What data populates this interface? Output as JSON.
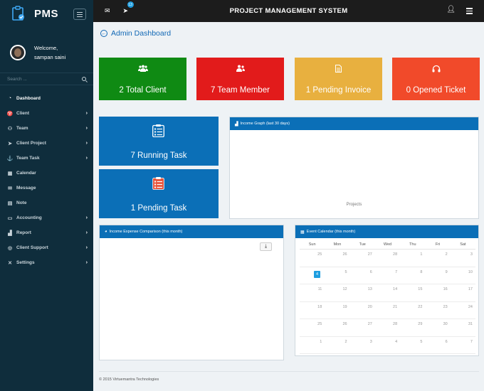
{
  "app": {
    "brand": "PMS",
    "title": "PROJECT MANAGEMENT SYSTEM"
  },
  "user": {
    "welcome": "Welcome,",
    "name": "sampan saini"
  },
  "search": {
    "placeholder": "Search ..."
  },
  "notifications": {
    "count": "13"
  },
  "sidebar": {
    "items": [
      {
        "label": "Dashboard",
        "icon": "dashboard-icon",
        "active": true
      },
      {
        "label": "Client",
        "icon": "trophy-icon",
        "has_children": true
      },
      {
        "label": "Team",
        "icon": "users-icon",
        "has_children": true
      },
      {
        "label": "Client Project",
        "icon": "send-icon",
        "has_children": true
      },
      {
        "label": "Team Task",
        "icon": "anchor-icon",
        "has_children": true
      },
      {
        "label": "Calendar",
        "icon": "calendar-icon"
      },
      {
        "label": "Message",
        "icon": "envelope-icon"
      },
      {
        "label": "Note",
        "icon": "note-icon"
      },
      {
        "label": "Accounting",
        "icon": "card-icon",
        "has_children": true
      },
      {
        "label": "Report",
        "icon": "bar-chart-icon",
        "has_children": true
      },
      {
        "label": "Client Support",
        "icon": "lifebuoy-icon",
        "has_children": true
      },
      {
        "label": "Settings",
        "icon": "tools-icon",
        "has_children": true
      }
    ]
  },
  "page": {
    "title": "Admin Dashboard"
  },
  "stats": [
    {
      "label": "2 Total Client",
      "color": "#0f8a13",
      "icon": "group-icon"
    },
    {
      "label": "7 Team Member",
      "color": "#e21b1b",
      "icon": "users-icon"
    },
    {
      "label": "1 Pending Invoice",
      "color": "#e8b03f",
      "icon": "file-icon"
    },
    {
      "label": "0 Opened Ticket",
      "color": "#f14a2a",
      "icon": "headphones-icon"
    }
  ],
  "tasks": [
    {
      "label": "7 Running Task",
      "icon": "task-list-icon"
    },
    {
      "label": "1 Pending Task",
      "icon": "task-list-icon"
    }
  ],
  "panels": {
    "income_graph": {
      "title": "Income Graph (last 30 days)",
      "axis_label": "Projects"
    },
    "expense": {
      "title": "Income Expense Comparison (this month)"
    },
    "calendar": {
      "title": "Event Calendar (this month)"
    }
  },
  "calendar": {
    "weekdays": [
      "Sun",
      "Mon",
      "Tue",
      "Wed",
      "Thu",
      "Fri",
      "Sat"
    ],
    "weeks": [
      [
        "25",
        "26",
        "27",
        "28",
        "1",
        "2",
        "3"
      ],
      [
        "4",
        "5",
        "6",
        "7",
        "8",
        "9",
        "10"
      ],
      [
        "11",
        "12",
        "13",
        "14",
        "15",
        "16",
        "17"
      ],
      [
        "18",
        "19",
        "20",
        "21",
        "22",
        "23",
        "24"
      ],
      [
        "25",
        "26",
        "27",
        "28",
        "29",
        "30",
        "31"
      ],
      [
        "1",
        "2",
        "3",
        "4",
        "5",
        "6",
        "7"
      ]
    ],
    "today": "4"
  },
  "footer": {
    "text": "© 2015 Virtuemantra Technologies"
  },
  "colors": {
    "sidebar": "#0f2d3c",
    "topbar": "#1c1c1c",
    "accent": "#0b6fb7"
  }
}
